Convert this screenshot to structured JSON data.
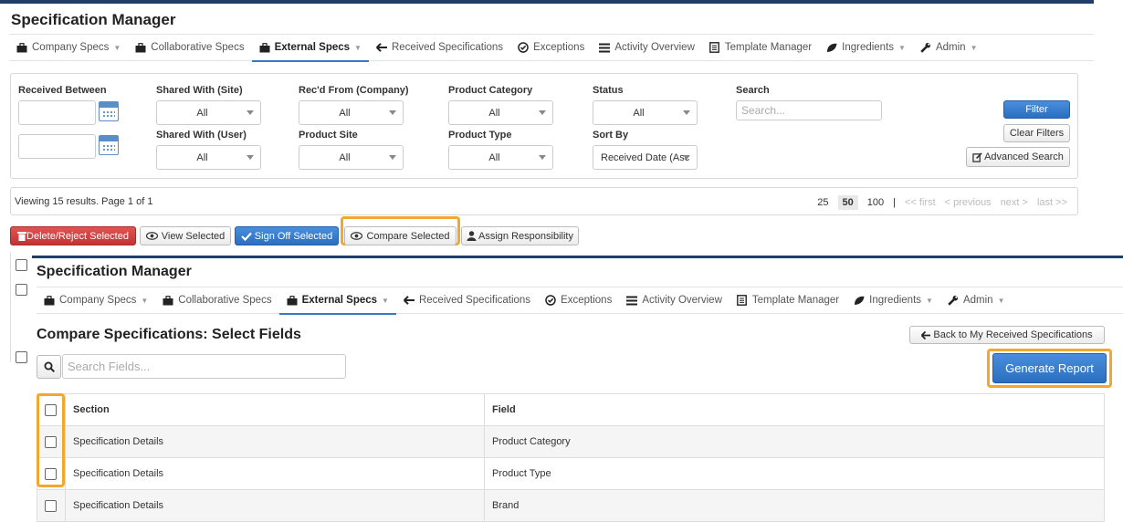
{
  "app_title": "Specification Manager",
  "nav": [
    {
      "label": "Company Specs",
      "icon": "briefcase-icon",
      "caret": true,
      "active": false
    },
    {
      "label": "Collaborative Specs",
      "icon": "briefcase-icon",
      "caret": false,
      "active": false
    },
    {
      "label": "External Specs",
      "icon": "briefcase-icon",
      "caret": true,
      "active": true
    },
    {
      "label": "Received Specifications",
      "icon": "arrow-left-icon",
      "caret": false,
      "active": false
    },
    {
      "label": "Exceptions",
      "icon": "check-circle-icon",
      "caret": false,
      "active": false
    },
    {
      "label": "Activity Overview",
      "icon": "list-icon",
      "caret": false,
      "active": false
    },
    {
      "label": "Template Manager",
      "icon": "document-icon",
      "caret": false,
      "active": false
    },
    {
      "label": "Ingredients",
      "icon": "leaf-icon",
      "caret": true,
      "active": false
    },
    {
      "label": "Admin",
      "icon": "wrench-icon",
      "caret": true,
      "active": false
    }
  ],
  "filters": {
    "received_between": "Received Between",
    "shared_with_site": {
      "label": "Shared With (Site)",
      "value": "All"
    },
    "recd_from_company": {
      "label": "Rec'd From (Company)",
      "value": "All"
    },
    "product_category": {
      "label": "Product Category",
      "value": "All"
    },
    "status": {
      "label": "Status",
      "value": "All"
    },
    "search": {
      "label": "Search",
      "placeholder": "Search..."
    },
    "shared_with_user": {
      "label": "Shared With (User)",
      "value": "All"
    },
    "product_site": {
      "label": "Product Site",
      "value": "All"
    },
    "product_type": {
      "label": "Product Type",
      "value": "All"
    },
    "sort_by": {
      "label": "Sort By",
      "value": "Received Date (Asc"
    },
    "filter_button": "Filter",
    "clear_button": "Clear Filters",
    "advanced_button": "Advanced Search"
  },
  "results": {
    "viewing": "Viewing 15 results. Page 1 of 1",
    "page_sizes": [
      "25",
      "50",
      "100"
    ],
    "selected_page_size": "50",
    "separator": "|",
    "first": "<< first",
    "previous": "< previous",
    "next": "next >",
    "last": "last >>"
  },
  "actions": {
    "delete_reject": "Delete/Reject Selected",
    "view_selected": "View Selected",
    "sign_off": "Sign Off Selected",
    "compare_selected": "Compare Selected",
    "assign": "Assign Responsibility"
  },
  "compare": {
    "title": "Compare Specifications: Select Fields",
    "back_button": "Back to My Received Specifications",
    "search_placeholder": "Search Fields...",
    "generate_button": "Generate Report",
    "columns": {
      "section": "Section",
      "field": "Field"
    },
    "rows": [
      {
        "section": "Specification Details",
        "field": "Product Category"
      },
      {
        "section": "Specification Details",
        "field": "Product Type"
      },
      {
        "section": "Specification Details",
        "field": "Brand"
      }
    ]
  },
  "colors": {
    "highlight": "#f0a830",
    "primary": "#2a6fc0",
    "danger": "#c43333",
    "header_bar": "#1f3f66"
  }
}
